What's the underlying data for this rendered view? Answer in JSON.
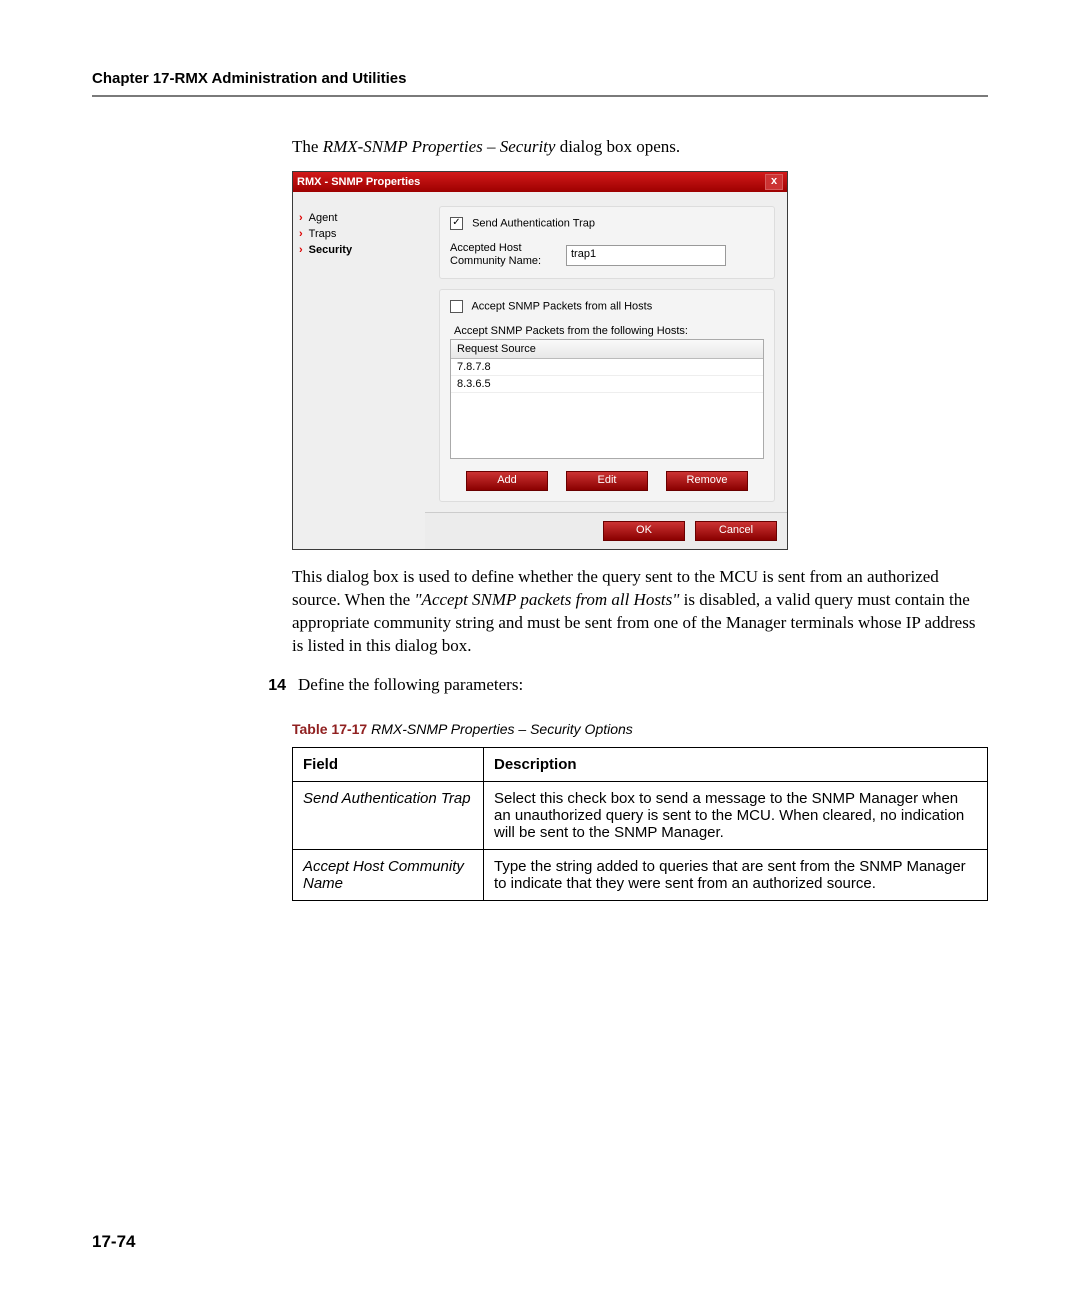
{
  "chapter_header": "Chapter 17-RMX Administration and Utilities",
  "intro": {
    "pre": "The ",
    "italic": "RMX-SNMP Properties – Security",
    "post": " dialog box opens."
  },
  "dialog": {
    "title": "RMX - SNMP Properties",
    "close": "x",
    "nav": {
      "agent": "Agent",
      "traps": "Traps",
      "security": "Security"
    },
    "send_auth_label": "Send Authentication Trap",
    "send_auth_checked": "✓",
    "host_label1": "Accepted Host",
    "host_label2": "Community Name:",
    "host_value": "trap1",
    "accept_all_label": "Accept SNMP Packets from all Hosts",
    "fieldset_title": "Accept SNMP Packets from the following Hosts:",
    "table_header": "Request Source",
    "rows": [
      "7.8.7.8",
      "8.3.6.5"
    ],
    "btn_add": "Add",
    "btn_edit": "Edit",
    "btn_remove": "Remove",
    "btn_ok": "OK",
    "btn_cancel": "Cancel"
  },
  "para": {
    "p1a": "This dialog box is used to define whether the query sent to the MCU is sent from an authorized source. When the ",
    "p1b_italic": "\"Accept SNMP packets from all Hosts\"",
    "p1c": " is disabled, a valid query must contain the appropriate community string and must be sent from one of the Manager terminals whose IP address is listed in this dialog box."
  },
  "step": {
    "num": "14",
    "text": "Define the following parameters:"
  },
  "table_caption": {
    "num": "Table 17-17",
    "text": " RMX-SNMP Properties – Security Options"
  },
  "table": {
    "h1": "Field",
    "h2": "Description",
    "r1f": "Send Authentication Trap",
    "r1d": "Select this check box to send a message to the SNMP Manager when an unauthorized query is sent to the MCU. When cleared, no indication will be sent to the SNMP Manager.",
    "r2f": "Accept Host Community Name",
    "r2d": "Type the string added to queries that are sent from the SNMP Manager to indicate that they were sent from an authorized source."
  },
  "page_num": "17-74"
}
